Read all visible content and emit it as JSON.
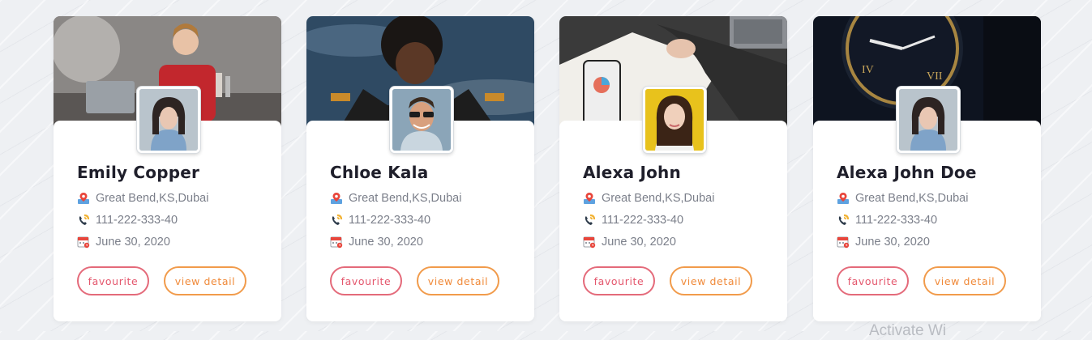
{
  "cards": [
    {
      "name": "Emily Copper",
      "location": "Great Bend,KS,Dubai",
      "phone": "111-222-333-40",
      "date": "June 30, 2020",
      "fav_label": "favourite",
      "view_label": "view detail",
      "cover": "woman-at-desk-photo",
      "avatar": "woman-bob-haircut-photo"
    },
    {
      "name": "Chloe Kala",
      "location": "Great Bend,KS,Dubai",
      "phone": "111-222-333-40",
      "date": "June 30, 2020",
      "fav_label": "favourite",
      "view_label": "view detail",
      "cover": "woman-curly-hair-sky-photo",
      "avatar": "man-sunglasses-photo"
    },
    {
      "name": "Alexa John",
      "location": "Great Bend,KS,Dubai",
      "phone": "111-222-333-40",
      "date": "June 30, 2020",
      "fav_label": "favourite",
      "view_label": "view detail",
      "cover": "hands-notebook-phone-photo",
      "avatar": "woman-yellow-background-photo"
    },
    {
      "name": "Alexa John Doe",
      "location": "Great Bend,KS,Dubai",
      "phone": "111-222-333-40",
      "date": "June 30, 2020",
      "fav_label": "favourite",
      "view_label": "view detail",
      "cover": "wristwatch-dark-photo",
      "avatar": "woman-bob-haircut-photo"
    }
  ],
  "watermark": "Activate Wi",
  "colors": {
    "favourite": "#e4576d",
    "view_detail": "#f08a3a",
    "name": "#1f1f2b",
    "info_text": "#7b7f8a"
  }
}
